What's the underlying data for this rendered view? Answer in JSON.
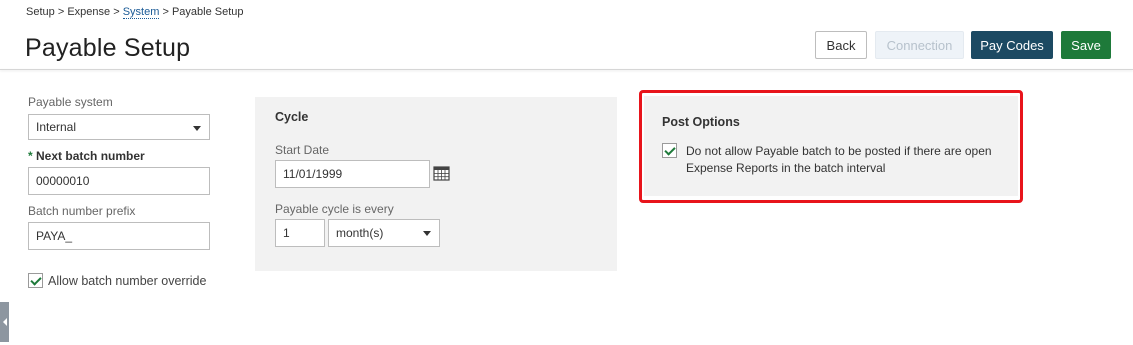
{
  "breadcrumb": {
    "setup": "Setup",
    "expense": "Expense",
    "system": "System",
    "current": "Payable Setup",
    "separator": ">"
  },
  "page": {
    "title": "Payable Setup"
  },
  "buttons": {
    "back": "Back",
    "connection": "Connection",
    "pay_codes": "Pay Codes",
    "save": "Save"
  },
  "left": {
    "payable_system_label": "Payable system",
    "payable_system_value": "Internal",
    "next_batch_label": "Next batch number",
    "next_batch_required": "*",
    "next_batch_value": "00000010",
    "prefix_label": "Batch number prefix",
    "prefix_value": "PAYA_",
    "allow_override_label": "Allow batch number override",
    "allow_override_checked": true
  },
  "cycle": {
    "title": "Cycle",
    "start_date_label": "Start Date",
    "start_date_value": "11/01/1999",
    "every_label": "Payable cycle is every",
    "every_value": "1",
    "unit_value": "month(s)"
  },
  "post_options": {
    "title": "Post Options",
    "option_line1": "Do not allow Payable batch to be posted if there are open",
    "option_line2": "Expense Reports in the batch interval",
    "option_checked": true
  },
  "colors": {
    "primary_dark": "#1c4a63",
    "save_green": "#1e7a3a",
    "highlight_red": "#e8141b",
    "link_blue": "#1a5a96"
  }
}
